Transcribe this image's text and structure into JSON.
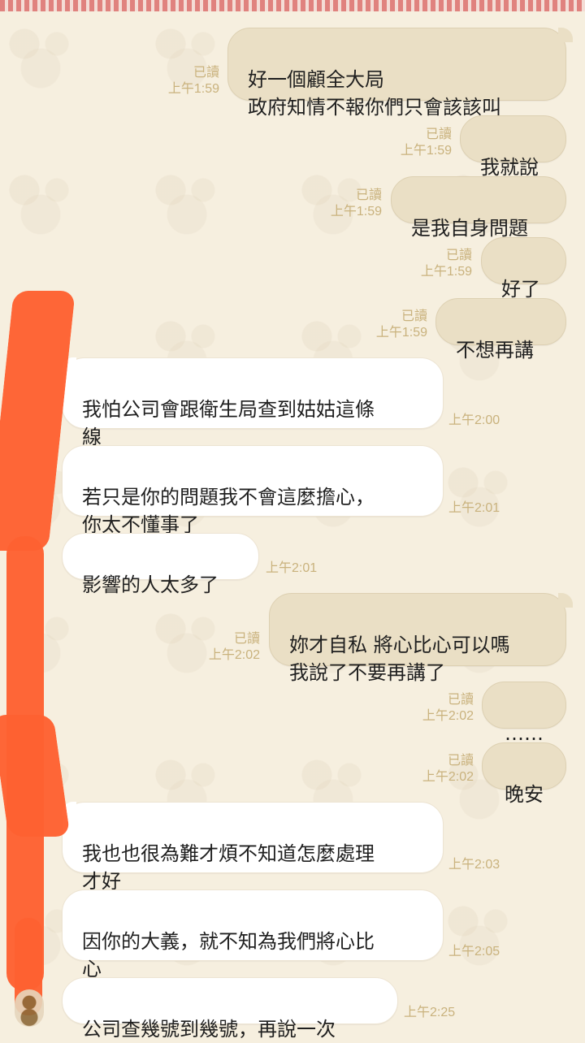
{
  "messages": [
    {
      "side": "out",
      "text": "好一個顧全大局\n政府知情不報你們只會該該叫",
      "read": "已讀",
      "time": "上午1:59"
    },
    {
      "side": "out",
      "text": "我就說",
      "read": "已讀",
      "time": "上午1:59"
    },
    {
      "side": "out",
      "text": "是我自身問題",
      "read": "已讀",
      "time": "上午1:59"
    },
    {
      "side": "out",
      "text": "好了",
      "read": "已讀",
      "time": "上午1:59"
    },
    {
      "side": "out",
      "text": "不想再講",
      "read": "已讀",
      "time": "上午1:59"
    },
    {
      "side": "in",
      "text": "我怕公司會跟衛生局查到姑姑這條\n線",
      "time": "上午2:00"
    },
    {
      "side": "in",
      "text": "若只是你的問題我不會這麼擔心，\n你太不懂事了",
      "time": "上午2:01"
    },
    {
      "side": "in",
      "text": "影響的人太多了",
      "time": "上午2:01"
    },
    {
      "side": "out",
      "text": "妳才自私 將心比心可以嗎\n我說了不要再講了",
      "read": "已讀",
      "time": "上午2:02"
    },
    {
      "side": "out",
      "text": "……",
      "read": "已讀",
      "time": "上午2:02"
    },
    {
      "side": "out",
      "text": "晚安",
      "read": "已讀",
      "time": "上午2:02"
    },
    {
      "side": "in",
      "text": "我也也很為難才煩不知道怎麼處理\n才好",
      "time": "上午2:03"
    },
    {
      "side": "in",
      "text": "因你的大義，就不知為我們將心比\n心",
      "time": "上午2:05"
    },
    {
      "side": "in",
      "text": "公司查幾號到幾號，再說一次",
      "time": "上午2:25"
    }
  ],
  "colors": {
    "background": "#f6efdf",
    "outgoing_bubble": "#eadfc5",
    "incoming_bubble": "#ffffff",
    "meta_text": "#c9b27d",
    "redaction": "#ff6131"
  }
}
